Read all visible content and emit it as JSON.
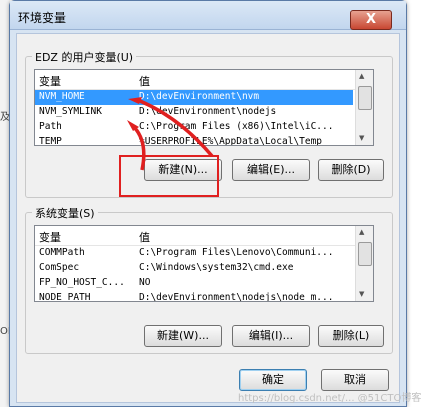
{
  "background": {
    "fragments": [
      "及",
      "ON"
    ]
  },
  "dialog": {
    "title": "环境变量",
    "close_label": "X"
  },
  "user_vars": {
    "group_label": "EDZ 的用户变量(U)",
    "col_var": "变量",
    "col_val": "值",
    "rows": [
      {
        "name": "NVM_HOME",
        "value": "D:\\devEnvironment\\nvm"
      },
      {
        "name": "NVM_SYMLINK",
        "value": "D:\\devEnvironment\\nodejs"
      },
      {
        "name": "Path",
        "value": "C:\\Program Files (x86)\\Intel\\iC..."
      },
      {
        "name": "TEMP",
        "value": "%USERPROFILE%\\AppData\\Local\\Temp"
      }
    ],
    "new_label": "新建(N)...",
    "edit_label": "编辑(E)...",
    "delete_label": "删除(D)"
  },
  "system_vars": {
    "group_label": "系统变量(S)",
    "col_var": "变量",
    "col_val": "值",
    "rows": [
      {
        "name": "COMMPath",
        "value": "C:\\Program Files\\Lenovo\\Communi..."
      },
      {
        "name": "ComSpec",
        "value": "C:\\Windows\\system32\\cmd.exe"
      },
      {
        "name": "FP_NO_HOST_C...",
        "value": "NO"
      },
      {
        "name": "NODE_PATH",
        "value": "D:\\devEnvironment\\nodejs\\node_m..."
      }
    ],
    "new_label": "新建(W)...",
    "edit_label": "编辑(I)...",
    "delete_label": "删除(L)"
  },
  "footer": {
    "ok_label": "确定",
    "cancel_label": "取消"
  },
  "watermark": "https://blog.csdn.net/...  @51CTO博客",
  "colors": {
    "selection": "#3399ff",
    "annotation": "#e02020"
  },
  "icons": [
    "close-icon",
    "scroll-up-icon",
    "scroll-down-icon",
    "annotation-arrow-icon"
  ]
}
